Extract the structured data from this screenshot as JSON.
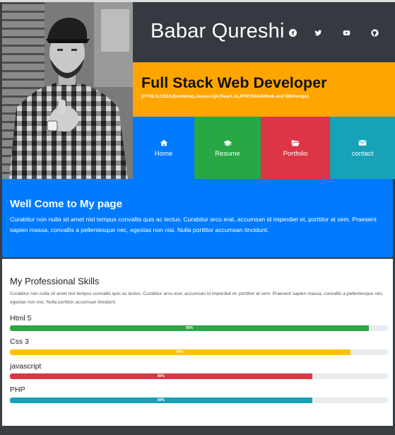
{
  "profile": {
    "name": "Babar Qureshi",
    "photo_alt": "profile-photo"
  },
  "social": [
    {
      "name": "facebook",
      "icon": "facebook-icon"
    },
    {
      "name": "twitter",
      "icon": "twitter-icon"
    },
    {
      "name": "youtube",
      "icon": "youtube-icon"
    },
    {
      "name": "github",
      "icon": "github-icon"
    }
  ],
  "role": {
    "title": "Full Stack Web Developer",
    "subtitle": "(HTML5,CSS3,Bootstrap,Javascript,React.Js,PHP,Git&Github and DBmongo)"
  },
  "nav": [
    {
      "label": "Home",
      "icon": "home-icon",
      "color": "#007bff"
    },
    {
      "label": "Resume",
      "icon": "graduation-cap-icon",
      "color": "#28a745"
    },
    {
      "label": "Portfolio",
      "icon": "folder-open-icon",
      "color": "#dc3545"
    },
    {
      "label": "contact",
      "icon": "envelope-icon",
      "color": "#17a2b8"
    }
  ],
  "welcome": {
    "heading": "Well Come to My page",
    "text": "Curabitur non nulla sit amet nisl tempus convallis quis ac lectus. Curabitur arcu erat, accumsan id imperdiet et, porttitor at sem. Praesent sapien massa, convallis a pellentesque nec, egestas non nisi. Nulla porttitor accumsan tincidunt."
  },
  "skills": {
    "heading": "My Professional Skills",
    "text": "Curabitur non nulla sit amet nisl tempus convallis quis ac lectus. Curabitur arcu erat, accumsan id imperdiet et, porttitor at sem. Praesent sapien massa, convallis a pellentesque nec, egestas non nisi. Nulla porttitor accumsan tincidunt.",
    "items": [
      {
        "name": "Html 5",
        "percent": 95,
        "label": "95%",
        "color": "#28a745"
      },
      {
        "name": "Css 3",
        "percent": 90,
        "label": "90%",
        "color": "#ffc107"
      },
      {
        "name": "javascript",
        "percent": 80,
        "label": "80%",
        "color": "#dc3545"
      },
      {
        "name": "PHP",
        "percent": 80,
        "label": "80%",
        "color": "#17a2b8"
      }
    ]
  }
}
